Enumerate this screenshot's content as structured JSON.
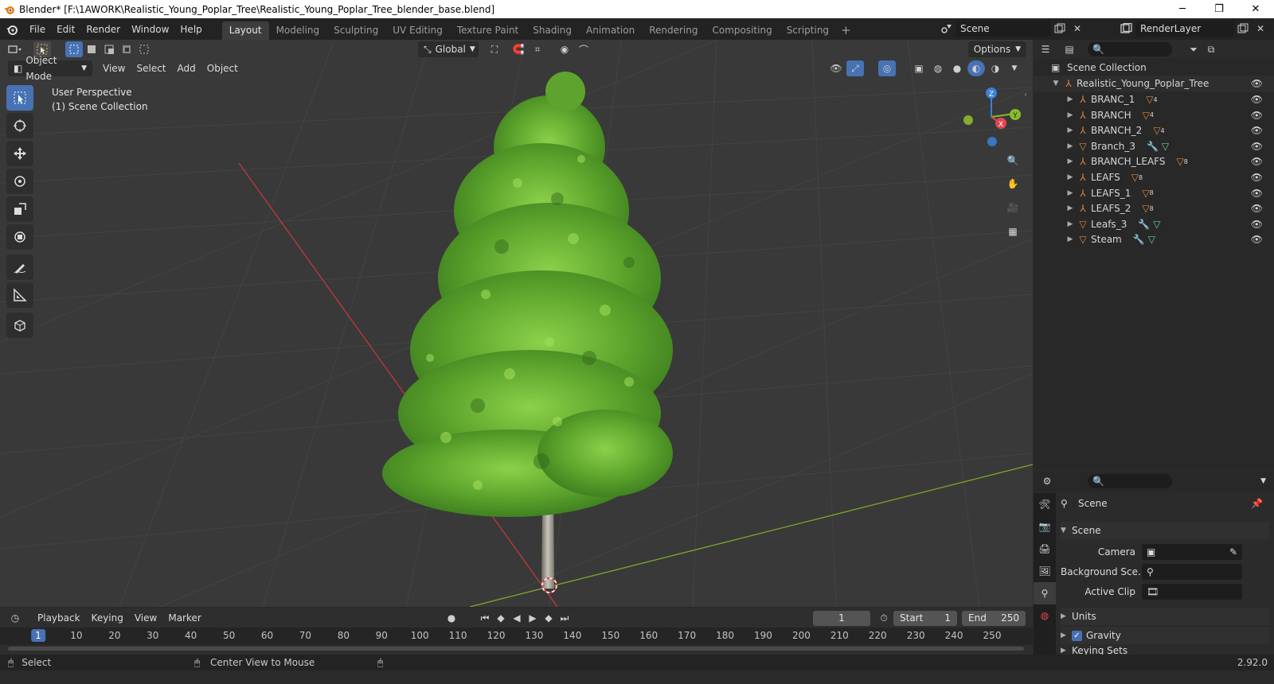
{
  "window": {
    "title": "Blender* [F:\\1AWORK\\Realistic_Young_Poplar_Tree\\Realistic_Young_Poplar_Tree_blender_base.blend]",
    "controls": [
      "─",
      "❐",
      "✕"
    ]
  },
  "menus": [
    "File",
    "Edit",
    "Render",
    "Window",
    "Help"
  ],
  "workspaces": {
    "active": "Layout",
    "tabs": [
      "Layout",
      "Modeling",
      "Sculpting",
      "UV Editing",
      "Texture Paint",
      "Shading",
      "Animation",
      "Rendering",
      "Compositing",
      "Scripting"
    ],
    "add": "+"
  },
  "scene": {
    "name": "Scene",
    "render_layer": "RenderLayer"
  },
  "viewport": {
    "transform_orientation": "Global",
    "options_label": "Options",
    "mode": "Object Mode",
    "menus": [
      "View",
      "Select",
      "Add",
      "Object"
    ],
    "overlay_line1": "User Perspective",
    "overlay_line2": "(1) Scene Collection",
    "gizmo": {
      "x": "X",
      "y": "Y",
      "z": "Z"
    }
  },
  "outliner": {
    "root": "Scene Collection",
    "collection": "Realistic_Young_Poplar_Tree",
    "items": [
      {
        "name": "BRANC_1",
        "kind": "armature",
        "badge": "4"
      },
      {
        "name": "BRANCH",
        "kind": "armature",
        "badge": "4"
      },
      {
        "name": "BRANCH_2",
        "kind": "armature",
        "badge": "4"
      },
      {
        "name": "Branch_3",
        "kind": "mesh",
        "badge": ""
      },
      {
        "name": "BRANCH_LEAFS",
        "kind": "armature",
        "badge": "8"
      },
      {
        "name": "LEAFS",
        "kind": "armature",
        "badge": "8"
      },
      {
        "name": "LEAFS_1",
        "kind": "armature",
        "badge": "8"
      },
      {
        "name": "LEAFS_2",
        "kind": "armature",
        "badge": "8"
      },
      {
        "name": "Leafs_3",
        "kind": "mesh",
        "badge": ""
      },
      {
        "name": "Steam",
        "kind": "mesh",
        "badge": ""
      }
    ]
  },
  "properties": {
    "context": "Scene",
    "panel": "Scene",
    "camera_label": "Camera",
    "bg_scene_label": "Background Sce...",
    "active_clip_label": "Active Clip",
    "units_label": "Units",
    "gravity_label": "Gravity",
    "gravity_checked": true,
    "keying_label": "Keying Sets"
  },
  "timeline": {
    "menus": [
      "Playback",
      "Keying",
      "View",
      "Marker"
    ],
    "current_frame": "1",
    "start_label": "Start",
    "start_value": "1",
    "end_label": "End",
    "end_value": "250",
    "ruler": [
      "1",
      "10",
      "20",
      "30",
      "40",
      "50",
      "60",
      "70",
      "80",
      "90",
      "100",
      "110",
      "120",
      "130",
      "140",
      "150",
      "160",
      "170",
      "180",
      "190",
      "200",
      "210",
      "220",
      "230",
      "240",
      "250"
    ]
  },
  "statusbar": {
    "left_action": "Select",
    "middle_action": "Center View to Mouse",
    "version": "2.92.0"
  },
  "colors": {
    "accent": "#4772b3",
    "x_axis": "#e0484f",
    "y_axis": "#8bba2c",
    "z_axis": "#3b7fdc",
    "object_orange": "#e0853a",
    "mesh_green": "#6ccf9b",
    "wrench_blue": "#6aa6e6"
  }
}
